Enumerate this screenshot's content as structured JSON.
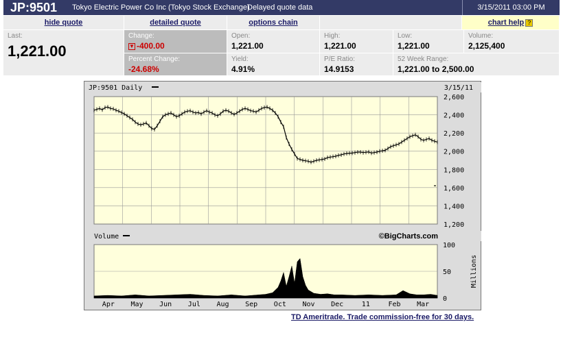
{
  "header": {
    "symbol": "JP:9501",
    "company": "Tokyo Electric Power Co Inc (Tokyo Stock Exchange)",
    "delayed": "Delayed quote data",
    "datetime": "3/15/2011 03:00 PM"
  },
  "links": {
    "hide_quote": "hide quote",
    "detailed_quote": "detailed quote",
    "options_chain": "options chain",
    "chart_help": "chart help",
    "help_mark": "?"
  },
  "quote": {
    "last_label": "Last:",
    "last": "1,221.00",
    "change_label": "Change:",
    "change": "-400.00",
    "pct_label": "Percent Change:",
    "pct": "-24.68%",
    "open_label": "Open:",
    "open": "1,221.00",
    "yield_label": "Yield:",
    "yield": "4.91%",
    "high_label": "High:",
    "high": "1,221.00",
    "pe_label": "P/E Ratio:",
    "pe": "14.9153",
    "low_label": "Low:",
    "low": "1,221.00",
    "vol_label": "Volume:",
    "vol": "2,125,400",
    "range_label": "52 Week Range:",
    "range": "1,221.00 to 2,500.00"
  },
  "ad_text": "TD Ameritrade. Trade commission-free for 30 days.",
  "colors": {
    "header_bg": "#333a66",
    "plot_bg": "#ffffdc",
    "negative": "#cc0000"
  },
  "chart_data": [
    {
      "type": "line",
      "title": "JP:9501 Daily",
      "date_label": "3/15/11",
      "ylim": [
        1200,
        2600
      ],
      "yticks": [
        "1,200",
        "1,400",
        "1,600",
        "1,800",
        "2,000",
        "2,200",
        "2,400",
        "2,600"
      ],
      "x_labels": [
        "Apr",
        "May",
        "Jun",
        "Jul",
        "Aug",
        "Sep",
        "Oct",
        "Nov",
        "Dec",
        "11",
        "Feb",
        "Mar"
      ],
      "grid": true,
      "x": [
        0,
        4,
        8,
        12,
        16,
        20,
        24,
        28,
        32,
        36,
        40,
        44,
        48,
        52,
        56,
        60,
        64,
        68,
        72,
        76,
        80,
        84,
        88,
        92,
        96,
        100,
        104,
        108,
        112,
        116,
        120,
        124,
        128,
        132,
        136,
        140,
        144,
        148,
        152,
        156,
        160,
        164,
        168,
        172,
        176,
        180,
        184,
        188,
        192,
        196,
        200,
        204,
        208,
        212,
        216,
        220,
        224,
        228,
        232,
        236,
        240,
        244,
        248,
        252,
        256,
        260,
        264,
        268,
        272,
        276,
        280,
        284,
        288,
        292,
        296,
        300,
        304,
        308,
        312,
        316,
        320,
        324,
        328,
        332,
        336,
        340,
        344,
        348,
        352,
        356,
        360,
        364,
        368,
        372,
        376,
        380,
        384,
        388,
        392,
        396,
        400,
        404,
        408,
        412,
        416,
        420,
        424,
        428,
        432,
        436,
        440,
        444,
        448,
        452,
        456,
        460,
        464,
        468,
        472,
        476,
        480,
        484,
        488,
        492,
        496,
        500
      ],
      "y": [
        2450,
        2460,
        2470,
        2455,
        2480,
        2485,
        2470,
        2465,
        2450,
        2440,
        2425,
        2410,
        2390,
        2370,
        2350,
        2320,
        2300,
        2290,
        2300,
        2310,
        2280,
        2250,
        2240,
        2280,
        2330,
        2380,
        2400,
        2410,
        2420,
        2400,
        2380,
        2390,
        2410,
        2430,
        2440,
        2445,
        2430,
        2420,
        2425,
        2410,
        2430,
        2445,
        2430,
        2420,
        2400,
        2390,
        2410,
        2440,
        2450,
        2440,
        2420,
        2405,
        2420,
        2440,
        2460,
        2470,
        2460,
        2445,
        2440,
        2430,
        2450,
        2470,
        2480,
        2485,
        2470,
        2450,
        2420,
        2380,
        2320,
        2270,
        2150,
        2080,
        2020,
        1970,
        1920,
        1910,
        1900,
        1895,
        1890,
        1880,
        1890,
        1900,
        1905,
        1910,
        1915,
        1930,
        1935,
        1940,
        1945,
        1955,
        1960,
        1970,
        1975,
        1978,
        1980,
        1985,
        1990,
        1990,
        1985,
        1988,
        1992,
        1980,
        1985,
        1990,
        2000,
        2005,
        2010,
        2030,
        2050,
        2060,
        2070,
        2080,
        2100,
        2120,
        2140,
        2160,
        2170,
        2180,
        2160,
        2130,
        2120,
        2130,
        2140,
        2120,
        2110,
        2100
      ]
    },
    {
      "type": "area",
      "title": "Volume",
      "watermark": "©BigCharts.com",
      "ylabel": "Millions",
      "ylim": [
        0,
        100
      ],
      "yticks": [
        "0",
        "50",
        "100"
      ],
      "x": [
        0,
        20,
        40,
        60,
        80,
        100,
        120,
        140,
        160,
        180,
        200,
        210,
        220,
        230,
        240,
        250,
        260,
        268,
        272,
        276,
        280,
        284,
        288,
        292,
        296,
        300,
        304,
        308,
        312,
        316,
        320,
        330,
        340,
        350,
        360,
        380,
        400,
        420,
        440,
        450,
        460,
        470,
        480,
        490,
        500
      ],
      "y": [
        4,
        5,
        4,
        6,
        4,
        5,
        6,
        7,
        5,
        4,
        6,
        5,
        4,
        5,
        6,
        7,
        10,
        20,
        32,
        48,
        22,
        40,
        60,
        28,
        68,
        74,
        40,
        24,
        15,
        12,
        9,
        7,
        8,
        6,
        6,
        5,
        6,
        5,
        6,
        14,
        8,
        6,
        6,
        7,
        5
      ]
    }
  ]
}
